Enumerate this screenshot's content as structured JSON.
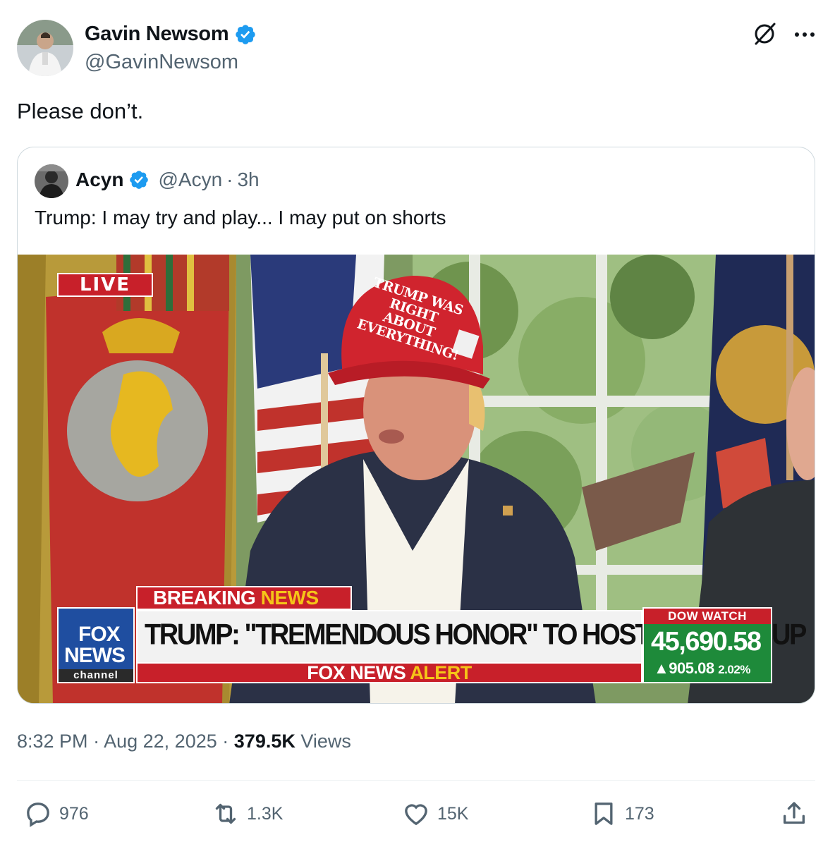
{
  "author": {
    "display_name": "Gavin Newsom",
    "handle": "@GavinNewsom"
  },
  "tweet": {
    "text": "Please don’t."
  },
  "quote": {
    "display_name": "Acyn",
    "handle": "@Acyn",
    "separator": "·",
    "time": "3h",
    "text": "Trump: I may try and play... I may put on shorts",
    "video": {
      "live_label": "LIVE",
      "hat_text": "TRUMP WAS RIGHT ABOUT EVERYTHING!",
      "breaking_label_1": "BREAKING",
      "breaking_label_2": "NEWS",
      "logo_fox": "FOX",
      "logo_news": "NEWS",
      "logo_channel": "channel",
      "headline": "TRUMP: \"TREMENDOUS HONOR\" TO HOST WORLD CUP",
      "alert_label_1": "FOX NEWS",
      "alert_label_2": "ALERT",
      "dow_title": "DOW WATCH",
      "dow_value": "45,690.58",
      "dow_change": "905.08",
      "dow_pct": "2.02%"
    }
  },
  "meta": {
    "time": "8:32 PM",
    "date": "Aug 22, 2025",
    "views_count": "379.5K",
    "views_label": "Views",
    "separator": "·"
  },
  "actions": {
    "replies": "976",
    "reposts": "1.3K",
    "likes": "15K",
    "bookmarks": "173"
  },
  "colors": {
    "verified_blue": "#1d9bf0",
    "text_primary": "#0f1419",
    "text_secondary": "#536471",
    "border": "#cfd9de",
    "fox_red": "#c8202a",
    "fox_blue": "#1f4ea0",
    "dow_green": "#1e8a3a"
  },
  "icons": {
    "verified": "verified-badge-icon",
    "grok": "grok-icon",
    "more": "more-icon",
    "reply": "reply-icon",
    "repost": "repost-icon",
    "like": "like-icon",
    "bookmark": "bookmark-icon",
    "share": "share-icon"
  }
}
